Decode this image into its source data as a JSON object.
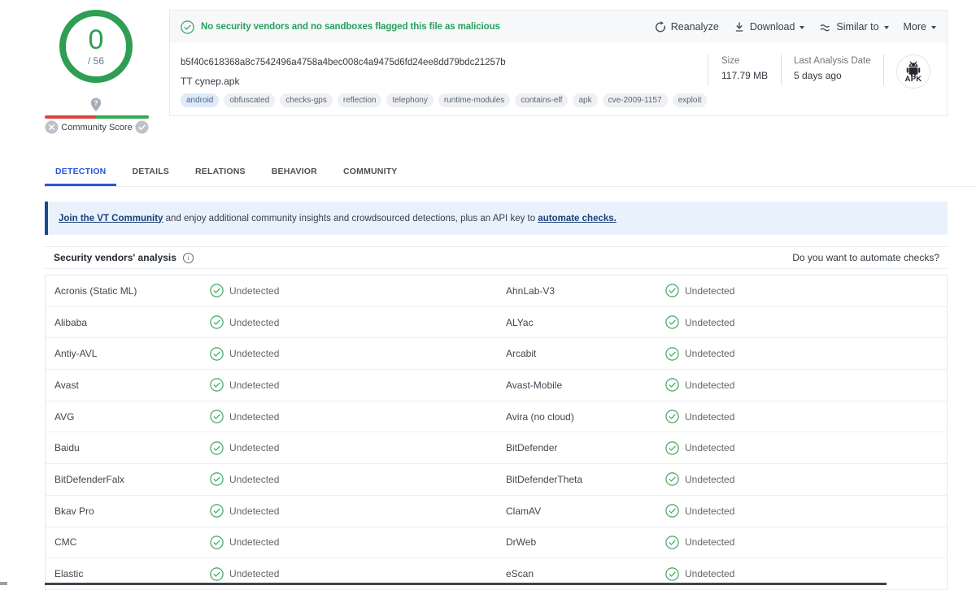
{
  "colors": {
    "green": "#2da35c",
    "ring_green": "#2e9e53",
    "red": "#d8453e",
    "active_tab_blue": "#2a56d9",
    "cta_bg": "#e9f2fc",
    "cta_border": "#17498f"
  },
  "score_widget": {
    "score": "0",
    "total": "/ 56",
    "community_label": "Community Score"
  },
  "header": {
    "verdict_message": "No security vendors and no sandboxes flagged this file as malicious",
    "actions": {
      "reanalyze": "Reanalyze",
      "download": "Download",
      "similar_to": "Similar to",
      "more": "More"
    },
    "sha256": "b5f40c618368a8c7542496a4758a4bec008c4a9475d6fd24ee8dd79bdc21257b",
    "filename": "TT cynep.apk",
    "tags": [
      "android",
      "obfuscated",
      "checks-gps",
      "reflection",
      "telephony",
      "runtime-modules",
      "contains-elf",
      "apk",
      "cve-2009-1157",
      "exploit"
    ],
    "size": {
      "label": "Size",
      "value": "117.79 MB"
    },
    "last_analysis": {
      "label": "Last Analysis Date",
      "value": "5 days ago"
    },
    "file_type_badge": "APK"
  },
  "tabs": [
    {
      "label": "DETECTION",
      "active": true
    },
    {
      "label": "DETAILS",
      "active": false
    },
    {
      "label": "RELATIONS",
      "active": false
    },
    {
      "label": "BEHAVIOR",
      "active": false
    },
    {
      "label": "COMMUNITY",
      "active": false
    }
  ],
  "community_banner": {
    "link_join": "Join the VT Community",
    "text_middle": " and enjoy additional community insights and crowdsourced detections, plus an API key to ",
    "link_automate": "automate checks."
  },
  "analysis": {
    "title": "Security vendors' analysis",
    "automate_prompt": "Do you want to automate checks?",
    "rows": [
      {
        "vendor_left": "Acronis (Static ML)",
        "status_left": "Undetected",
        "vendor_right": "AhnLab-V3",
        "status_right": "Undetected"
      },
      {
        "vendor_left": "Alibaba",
        "status_left": "Undetected",
        "vendor_right": "ALYac",
        "status_right": "Undetected"
      },
      {
        "vendor_left": "Antiy-AVL",
        "status_left": "Undetected",
        "vendor_right": "Arcabit",
        "status_right": "Undetected"
      },
      {
        "vendor_left": "Avast",
        "status_left": "Undetected",
        "vendor_right": "Avast-Mobile",
        "status_right": "Undetected"
      },
      {
        "vendor_left": "AVG",
        "status_left": "Undetected",
        "vendor_right": "Avira (no cloud)",
        "status_right": "Undetected"
      },
      {
        "vendor_left": "Baidu",
        "status_left": "Undetected",
        "vendor_right": "BitDefender",
        "status_right": "Undetected"
      },
      {
        "vendor_left": "BitDefenderFalx",
        "status_left": "Undetected",
        "vendor_right": "BitDefenderTheta",
        "status_right": "Undetected"
      },
      {
        "vendor_left": "Bkav Pro",
        "status_left": "Undetected",
        "vendor_right": "ClamAV",
        "status_right": "Undetected"
      },
      {
        "vendor_left": "CMC",
        "status_left": "Undetected",
        "vendor_right": "DrWeb",
        "status_right": "Undetected"
      },
      {
        "vendor_left": "Elastic",
        "status_left": "Undetected",
        "vendor_right": "eScan",
        "status_right": "Undetected"
      }
    ]
  }
}
